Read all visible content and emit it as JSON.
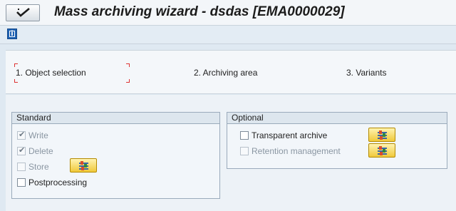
{
  "window": {
    "title": "Mass archiving wizard - dsdas [EMA0000029]"
  },
  "toolbar": {
    "info_icon": "i"
  },
  "steps": {
    "items": [
      {
        "label": "1. Object selection",
        "active": true
      },
      {
        "label": "2. Archiving area",
        "active": false
      },
      {
        "label": "3. Variants",
        "active": false
      }
    ]
  },
  "standard": {
    "title": "Standard",
    "write": {
      "label": "Write",
      "checked": true,
      "enabled": false
    },
    "delete": {
      "label": "Delete",
      "checked": true,
      "enabled": false
    },
    "store": {
      "label": "Store",
      "checked": false,
      "enabled": false
    },
    "postprocessing": {
      "label": "Postprocessing",
      "checked": false,
      "enabled": true
    }
  },
  "optional": {
    "title": "Optional",
    "transparent_archive": {
      "label": "Transparent archive",
      "checked": false,
      "enabled": true
    },
    "retention_management": {
      "label": "Retention management",
      "checked": false,
      "enabled": false
    }
  },
  "colors": {
    "accent_red": "#dd3333",
    "button_yellow": "#f0c93a",
    "info_blue": "#1f62b3"
  }
}
